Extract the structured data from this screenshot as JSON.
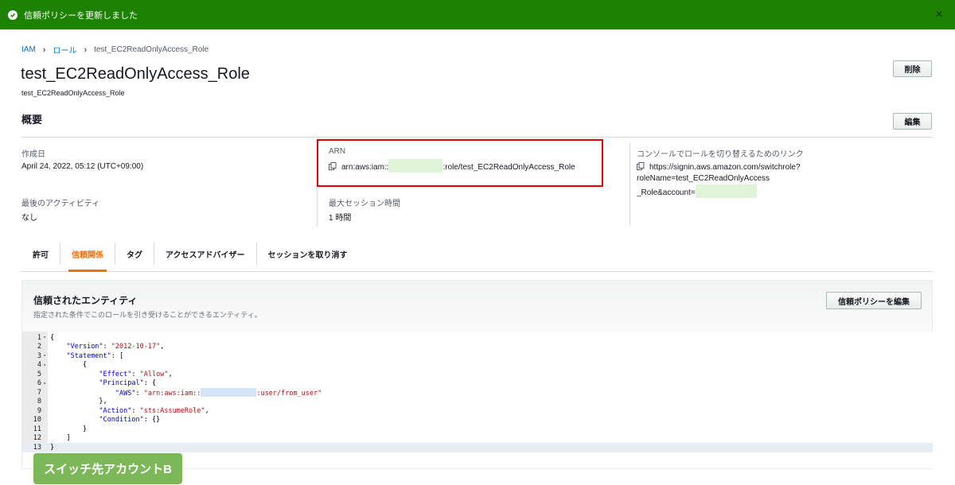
{
  "flash": {
    "message": "信頼ポリシーを更新しました"
  },
  "breadcrumb": {
    "item1": "IAM",
    "item2": "ロール",
    "current": "test_EC2ReadOnlyAccess_Role"
  },
  "page": {
    "title": "test_EC2ReadOnlyAccess_Role",
    "subtitle": "test_EC2ReadOnlyAccess_Role",
    "delete_label": "削除",
    "edit_label": "編集",
    "section_title": "概要"
  },
  "summary": {
    "created_label": "作成日",
    "created_value": "April 24, 2022, 05:12 (UTC+09:00)",
    "arn_label": "ARN",
    "arn_prefix": "arn:aws:iam::",
    "arn_suffix": ":role/test_EC2ReadOnlyAccess_Role",
    "link_label": "コンソールでロールを切り替えるためのリンク",
    "link_line1": "https://signin.aws.amazon.com/switchrole?roleName=test_EC2ReadOnlyAccess",
    "link_line2": "_Role&account=",
    "last_activity_label": "最後のアクティビティ",
    "last_activity_value": "なし",
    "max_session_label": "最大セッション時間",
    "max_session_value": "1 時間"
  },
  "tabs": [
    "許可",
    "信頼関係",
    "タグ",
    "アクセスアドバイザー",
    "セッションを取り消す"
  ],
  "active_tab": "信頼関係",
  "trusted": {
    "title": "信頼されたエンティティ",
    "description": "指定された条件でこのロールを引き受けることができるエンティティ。",
    "edit_button": "信頼ポリシーを編集"
  },
  "policy_lines": [
    {
      "n": "1",
      "fold": true
    },
    {
      "n": "2",
      "fold": false
    },
    {
      "n": "3",
      "fold": true
    },
    {
      "n": "4",
      "fold": true
    },
    {
      "n": "5",
      "fold": false
    },
    {
      "n": "6",
      "fold": true
    },
    {
      "n": "7",
      "fold": false
    },
    {
      "n": "8",
      "fold": false
    },
    {
      "n": "9",
      "fold": false
    },
    {
      "n": "10",
      "fold": false
    },
    {
      "n": "11",
      "fold": false
    },
    {
      "n": "12",
      "fold": false
    },
    {
      "n": "13",
      "fold": false
    }
  ],
  "policy": {
    "version_key": "\"Version\"",
    "version_val": "\"2012-10-17\"",
    "statement_key": "\"Statement\"",
    "effect_key": "\"Effect\"",
    "effect_val": "\"Allow\"",
    "principal_key": "\"Principal\"",
    "aws_key": "\"AWS\"",
    "aws_val_prefix": "\"arn:aws:iam::",
    "aws_val_suffix": ":user/from_user\"",
    "action_key": "\"Action\"",
    "action_val": "\"sts:AssumeRole\"",
    "condition_key": "\"Condition\""
  },
  "badge": {
    "label": "スイッチ先アカウントB"
  },
  "colors": {
    "flash": "#1d8102",
    "highlight": "#e40000",
    "tab_active": "#ec7211",
    "badge": "#7cb857"
  }
}
